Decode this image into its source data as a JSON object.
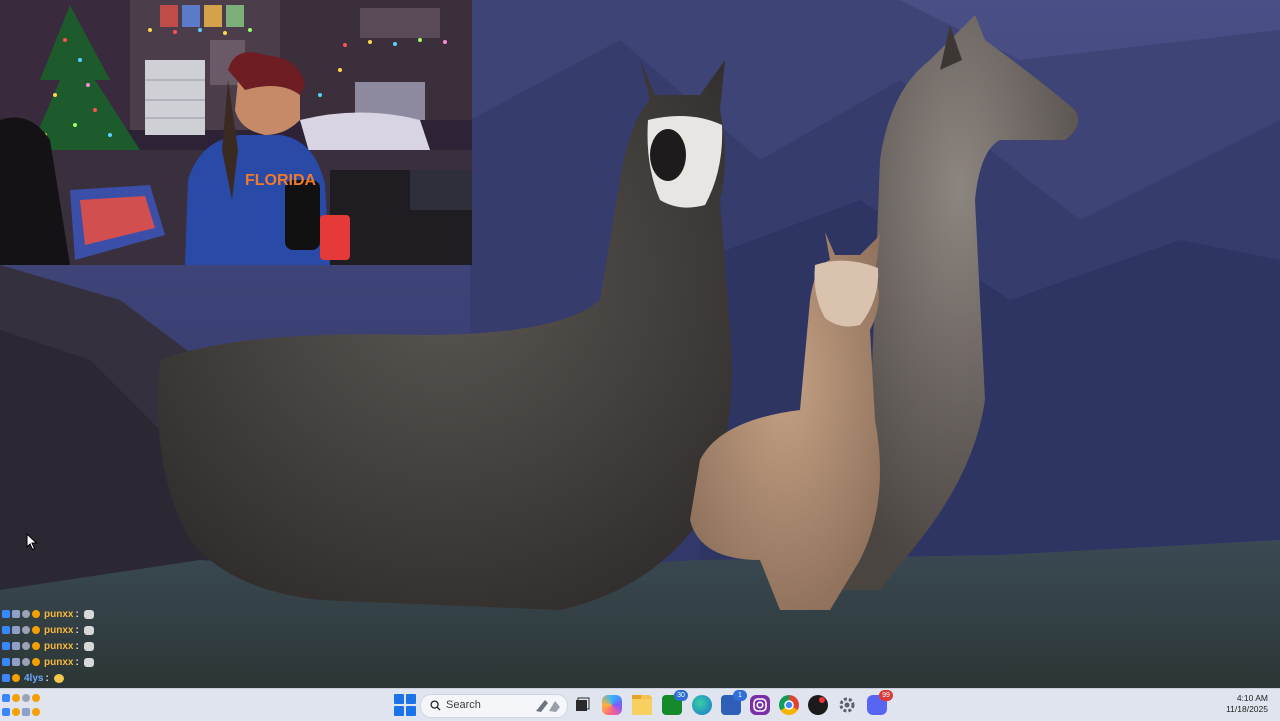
{
  "webcam": {
    "shirt_text": "FLORIDA"
  },
  "chat": {
    "lines": [
      {
        "user": "punxx",
        "sep": ":"
      },
      {
        "user": "punxx",
        "sep": ":"
      },
      {
        "user": "punxx",
        "sep": ":"
      },
      {
        "user": "punxx",
        "sep": ":"
      },
      {
        "user": "4lys",
        "sep": ":"
      }
    ]
  },
  "taskbar": {
    "search_label": "Search",
    "icons": [
      {
        "name": "task-view-icon"
      },
      {
        "name": "copilot-icon"
      },
      {
        "name": "file-explorer-icon"
      },
      {
        "name": "xbox-icon",
        "badge": "30"
      },
      {
        "name": "edge-icon"
      },
      {
        "name": "store-icon",
        "badge": "1"
      },
      {
        "name": "instagram-icon"
      },
      {
        "name": "chrome-icon"
      },
      {
        "name": "obs-icon"
      },
      {
        "name": "settings-icon"
      },
      {
        "name": "discord-icon",
        "badge": "99"
      }
    ],
    "clock_time": "4:10 AM",
    "clock_date": "11/18/2025"
  },
  "colors": {
    "taskbar_bg": "#dfe4ee",
    "chat_username": "#f6b73c",
    "wallpaper_sky": "#3a3f6e"
  }
}
